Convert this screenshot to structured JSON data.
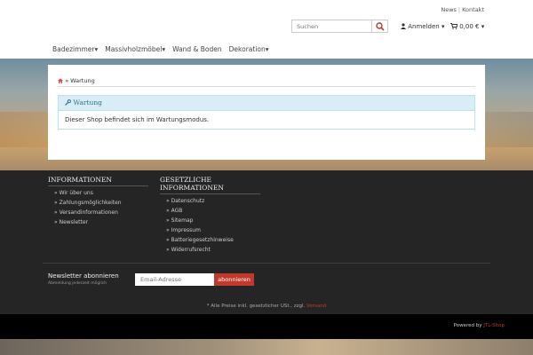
{
  "header": {
    "top_links": [
      "News",
      "Kontakt"
    ],
    "search_placeholder": "Suchen",
    "account_label": "Anmelden",
    "cart_label": "0,00 €",
    "nav": [
      "Badezimmer",
      "Massivholzmöbel",
      "Wand & Boden",
      "Dekoration"
    ]
  },
  "breadcrumb": {
    "current": "Wartung"
  },
  "alert": {
    "title": "Wartung",
    "message": "Dieser Shop befindet sich im Wartungsmodus."
  },
  "footer": {
    "col1": {
      "title": "INFORMATIONEN",
      "items": [
        "» Wir über uns",
        "» Zahlungsmöglichkeiten",
        "» Versandinformationen",
        "» Newsletter"
      ]
    },
    "col2": {
      "title": "GESETZLICHE INFORMATIONEN",
      "items": [
        "» Datenschutz",
        "» AGB",
        "» Sitemap",
        "» Impressum",
        "» Batteriegesetzhinweise",
        "» Widerrufsrecht"
      ]
    },
    "newsletter": {
      "title": "Newsletter abonnieren",
      "subtitle": "Abmeldung jederzeit möglich",
      "placeholder": "Email-Adresse",
      "button": "abonnieren"
    },
    "vat_text": "* Alle Preise inkl. gesetzlicher USt., zzgl.",
    "vat_link": "Versand",
    "powered_text": "Powered by",
    "powered_link": "JTL-Shop"
  },
  "colors": {
    "accent": "#c0392b",
    "alert_bg": "#d9edf7",
    "footer_bg": "#252525"
  }
}
